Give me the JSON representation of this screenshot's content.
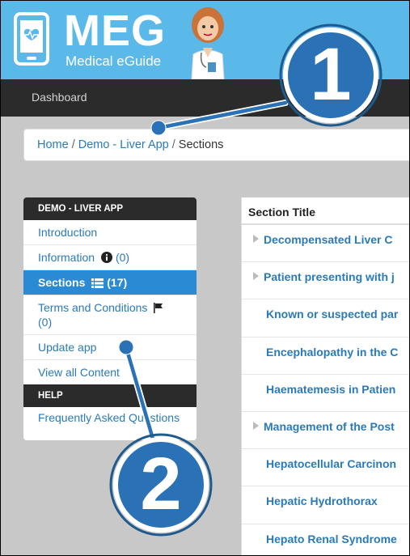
{
  "header": {
    "logo_title": "MEG",
    "logo_subtitle": "Medical eGuide",
    "brand_color": "#5bb9ea"
  },
  "navbar": {
    "dashboard_label": "Dashboard"
  },
  "breadcrumb": {
    "home": "Home",
    "separator": "/",
    "app": "Demo - Liver App",
    "current": "Sections"
  },
  "sidebar": {
    "app_heading": "DEMO - LIVER APP",
    "items": [
      {
        "label": "Introduction",
        "count": ""
      },
      {
        "label": "Information",
        "count": "(0)",
        "icon": "info-icon"
      },
      {
        "label": "Sections",
        "count": "(17)",
        "icon": "list-icon",
        "active": true
      },
      {
        "label": "Terms and Conditions",
        "count": "(0)",
        "icon": "flag-icon"
      },
      {
        "label": "Update app",
        "count": ""
      },
      {
        "label": "View all Content",
        "count": ""
      }
    ],
    "help_heading": "HELP",
    "help_items": [
      {
        "label": "Frequently Asked Questions"
      }
    ]
  },
  "table": {
    "header": "Section Title",
    "rows": [
      {
        "title": "Decompensated Liver C",
        "expandable": true
      },
      {
        "title": "Patient presenting with j",
        "expandable": true
      },
      {
        "title": "Known or suspected par",
        "expandable": false
      },
      {
        "title": "Encephalopathy in the C",
        "expandable": false
      },
      {
        "title": "Haematemesis in Patien",
        "expandable": false
      },
      {
        "title": "Management of the Post",
        "expandable": true
      },
      {
        "title": "Hepatocellular Carcinon",
        "expandable": false
      },
      {
        "title": "Hepatic Hydrothorax",
        "expandable": false
      },
      {
        "title": "Hepato Renal Syndrome",
        "expandable": false
      }
    ]
  },
  "callouts": {
    "one": "1",
    "two": "2",
    "color": "#2a72b5"
  }
}
